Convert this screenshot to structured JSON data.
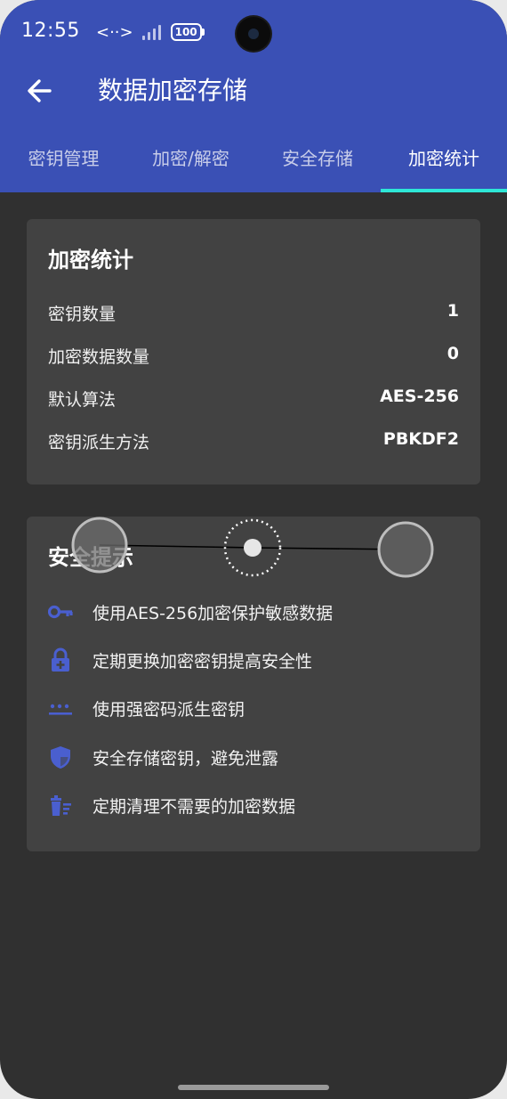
{
  "status_bar": {
    "time": "12:55",
    "nfc": "<··>",
    "battery": "100"
  },
  "app_bar": {
    "title": "数据加密存储"
  },
  "tabs": [
    {
      "label": "密钥管理"
    },
    {
      "label": "加密/解密"
    },
    {
      "label": "安全存储"
    },
    {
      "label": "加密统计",
      "active": true
    }
  ],
  "stats_card": {
    "title": "加密统计",
    "rows": [
      {
        "label": "密钥数量",
        "value": "1"
      },
      {
        "label": "加密数据数量",
        "value": "0"
      },
      {
        "label": "默认算法",
        "value": "AES-256"
      },
      {
        "label": "密钥派生方法",
        "value": "PBKDF2"
      }
    ]
  },
  "tips_card": {
    "title": "安全提示",
    "tips": [
      {
        "icon": "key-icon",
        "text": "使用AES-256加密保护敏感数据"
      },
      {
        "icon": "lock-icon",
        "text": "定期更换加密密钥提高安全性"
      },
      {
        "icon": "password-icon",
        "text": "使用强密码派生密钥"
      },
      {
        "icon": "shield-icon",
        "text": "安全存储密钥，避免泄露"
      },
      {
        "icon": "trash-list-icon",
        "text": "定期清理不需要的加密数据"
      }
    ]
  },
  "colors": {
    "app_bar": "#3a50b5",
    "tab_indicator": "#2ee6d6",
    "background": "#303030",
    "card": "#424242",
    "icon_accent": "#4a5fcf"
  }
}
